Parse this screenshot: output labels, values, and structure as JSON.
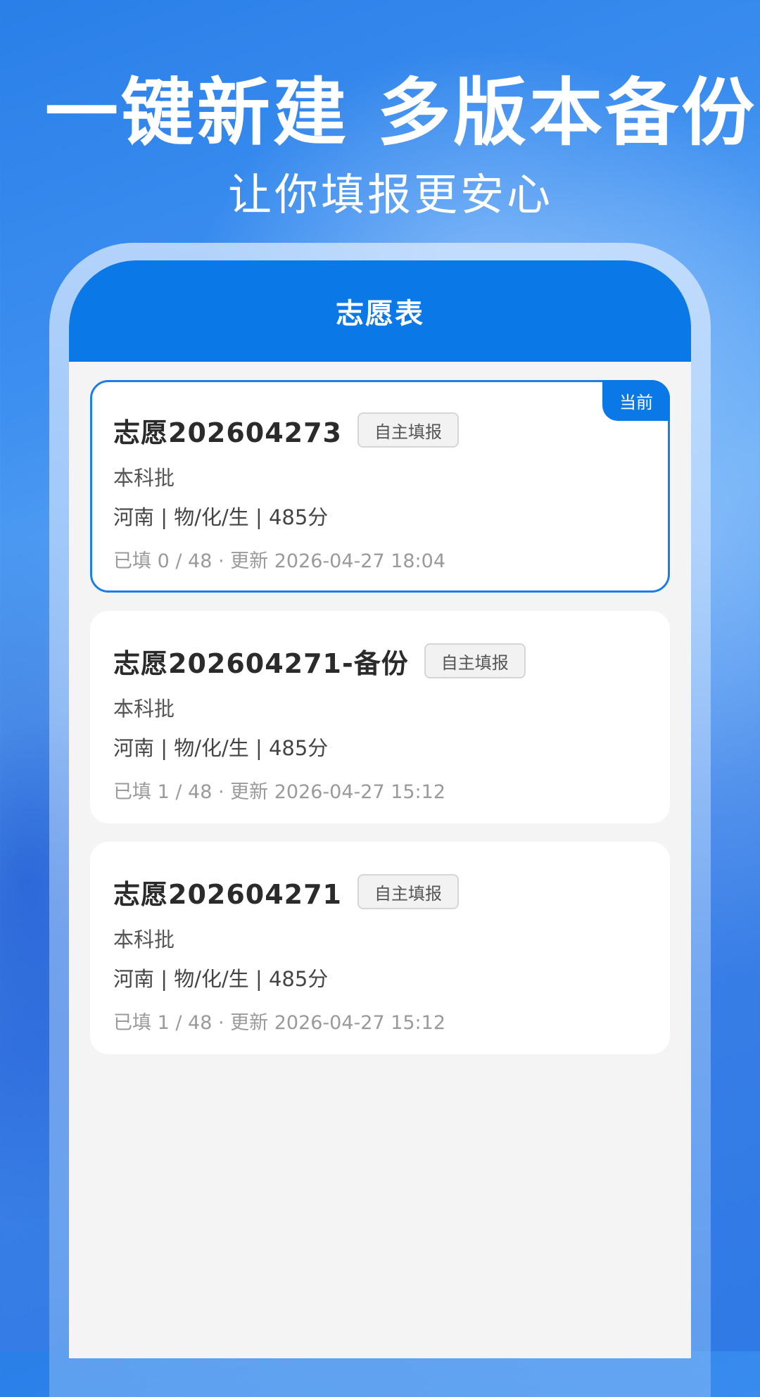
{
  "hero": {
    "title": "一键新建  多版本备份",
    "subtitle": "让你填报更安心"
  },
  "header": {
    "title": "志愿表"
  },
  "cards": [
    {
      "name": "志愿202604273",
      "tag": "自主填报",
      "batch": "本科批",
      "info": "河南 | 物/化/生 | 485分",
      "meta": "已填 0 / 48 · 更新 2026-04-27 18:04",
      "badge": "当前"
    },
    {
      "name": "志愿202604271-备份",
      "tag": "自主填报",
      "batch": "本科批",
      "info": "河南 | 物/化/生 | 485分",
      "meta": "已填 1 / 48 · 更新 2026-04-27 15:12"
    },
    {
      "name": "志愿202604271",
      "tag": "自主填报",
      "batch": "本科批",
      "info": "河南 | 物/化/生 | 485分",
      "meta": "已填 1 / 48 · 更新 2026-04-27 15:12"
    }
  ],
  "colors": {
    "primary": "#0b78e8",
    "background": "#f4f4f4"
  }
}
